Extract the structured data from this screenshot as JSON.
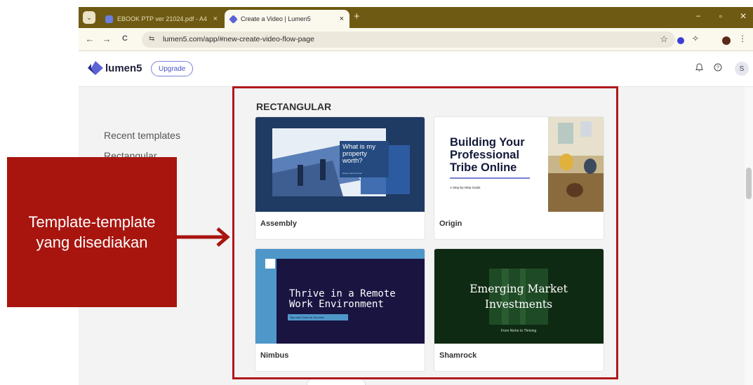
{
  "browser": {
    "tabs": [
      {
        "title": "EBOOK PTP ver 21024.pdf - A4",
        "close": "×"
      },
      {
        "title": "Create a Video | Lumen5",
        "close": "×"
      }
    ],
    "new_tab": "+",
    "window_controls": {
      "minimize": "−",
      "restore": "▫",
      "close": "✕"
    },
    "nav": {
      "back": "←",
      "forward": "→",
      "reload": "C"
    },
    "url": "lumen5.com/app/#new-create-video-flow-page",
    "star": "☆",
    "extensions_icon": "✧",
    "menu": "⋮",
    "tab_menu": "⌄"
  },
  "app": {
    "brand": "lumen5",
    "upgrade_label": "Upgrade",
    "icons": {
      "bell": "🔔",
      "help": "?"
    },
    "avatar_initial": "S"
  },
  "sidebar": {
    "items": [
      {
        "label": "Recent templates"
      },
      {
        "label": "Rectangular"
      }
    ]
  },
  "main": {
    "section_title": "RECTANGULAR",
    "templates": [
      {
        "name": "Assembly",
        "thumb_text": "What is my property worth?",
        "thumb_sub": "All you need to know"
      },
      {
        "name": "Origin",
        "thumb_text": "Building Your Professional Tribe Online",
        "thumb_sub": "A Step-by-Step Guide"
      },
      {
        "name": "Nimbus",
        "thumb_text": "Thrive in a Remote Work Environment",
        "thumb_sub": "Tips and Tricks for Success"
      },
      {
        "name": "Shamrock",
        "thumb_text": "Emerging Market Investments",
        "thumb_sub": "From Niche to Thriving"
      }
    ]
  },
  "annotation": {
    "callout_text": "Template-template yang disediakan"
  },
  "colors": {
    "tabstrip": "#6e5a12",
    "annotation_red": "#b0191c",
    "brand_blue": "#4a52c4"
  }
}
